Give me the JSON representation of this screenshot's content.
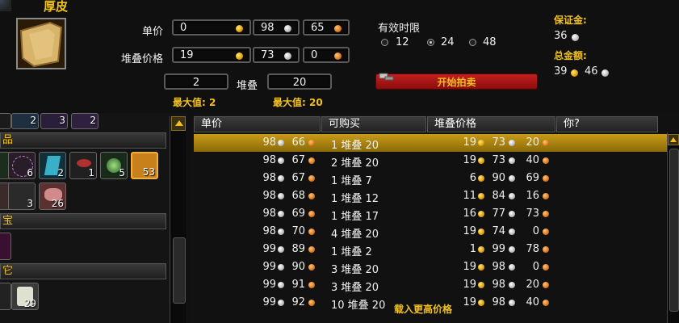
{
  "item": {
    "name": "厚皮",
    "icon": "leather-hide-icon"
  },
  "form": {
    "unit_price_label": "单价",
    "unit_price": {
      "gold": "0",
      "silver": "98",
      "copper": "65"
    },
    "stack_price_label": "堆叠价格",
    "stack_price": {
      "gold": "19",
      "silver": "73",
      "copper": "0"
    },
    "stack_count": "2",
    "stack_count_max": "最大值: 2",
    "stack_label": "堆叠",
    "stack_size": "20",
    "stack_size_max": "最大值: 20"
  },
  "duration": {
    "label": "有效时限",
    "options": [
      "12",
      "24",
      "48"
    ],
    "selected": "24"
  },
  "deposit": {
    "label": "保证金:",
    "silver": "36"
  },
  "total": {
    "label": "总金额:",
    "gold": "39",
    "silver": "46"
  },
  "start_button": "开始拍卖",
  "categories": [
    "品",
    "宝",
    "它"
  ],
  "inventory": {
    "row_top_counts": [
      "2",
      "3",
      "2"
    ],
    "row1_counts": [
      "6",
      "2",
      "1",
      "5",
      "53"
    ],
    "row2_counts": [
      "3",
      "26"
    ],
    "row4_counts": [
      "29"
    ]
  },
  "table": {
    "headers": [
      "单价",
      "可购买",
      "堆叠价格",
      "你?"
    ],
    "rows": [
      {
        "unit_s": "98",
        "unit_c": "66",
        "qty": "1 堆叠 20",
        "sg": "19",
        "ss": "73",
        "sc": "20"
      },
      {
        "unit_s": "98",
        "unit_c": "67",
        "qty": "2 堆叠 20",
        "sg": "19",
        "ss": "73",
        "sc": "40"
      },
      {
        "unit_s": "98",
        "unit_c": "67",
        "qty": "1 堆叠 7",
        "sg": "6",
        "ss": "90",
        "sc": "69"
      },
      {
        "unit_s": "98",
        "unit_c": "68",
        "qty": "1 堆叠 12",
        "sg": "11",
        "ss": "84",
        "sc": "16"
      },
      {
        "unit_s": "98",
        "unit_c": "69",
        "qty": "1 堆叠 17",
        "sg": "16",
        "ss": "77",
        "sc": "73"
      },
      {
        "unit_s": "98",
        "unit_c": "70",
        "qty": "4 堆叠 20",
        "sg": "19",
        "ss": "74",
        "sc": "0"
      },
      {
        "unit_s": "99",
        "unit_c": "89",
        "qty": "1 堆叠 2",
        "sg": "1",
        "ss": "99",
        "sc": "78"
      },
      {
        "unit_s": "99",
        "unit_c": "90",
        "qty": "3 堆叠 20",
        "sg": "19",
        "ss": "98",
        "sc": "0"
      },
      {
        "unit_s": "99",
        "unit_c": "91",
        "qty": "3 堆叠 20",
        "sg": "19",
        "ss": "98",
        "sc": "20"
      },
      {
        "unit_s": "99",
        "unit_c": "92",
        "qty": "10 堆叠 20",
        "sg": "19",
        "ss": "98",
        "sc": "40"
      }
    ],
    "buy_higher": "载入更高价格"
  },
  "colors": {
    "gold_text": "#f2c21c",
    "selected_row": "#b08a10",
    "button_red": "#a81414"
  }
}
